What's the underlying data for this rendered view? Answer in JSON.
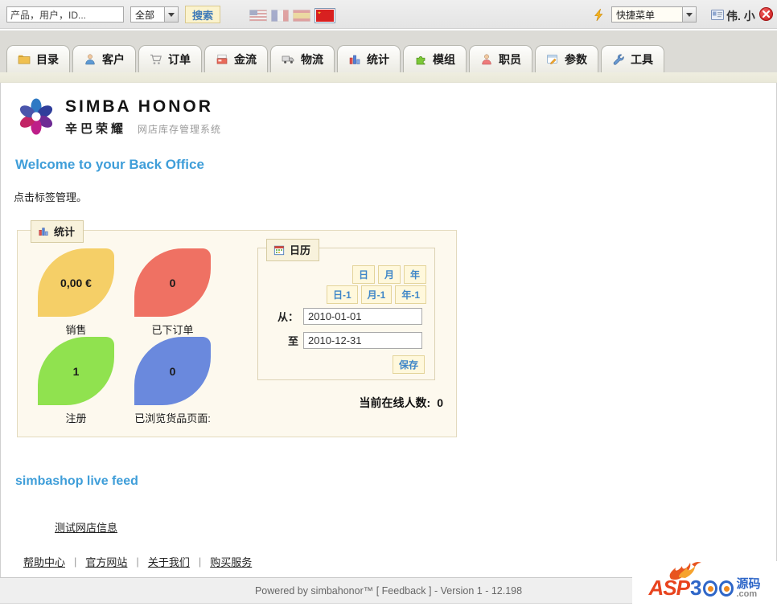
{
  "topbar": {
    "search_value": "产品，用户，ID...",
    "category_value": "全部",
    "search_button": "搜索",
    "flags": [
      "us-flag",
      "france-flag",
      "spain-flag",
      "china-flag-selected"
    ],
    "quick_menu_value": "快捷菜单",
    "username": "伟. 小"
  },
  "tabs": [
    {
      "label": "目录"
    },
    {
      "label": "客户"
    },
    {
      "label": "订单"
    },
    {
      "label": "金流"
    },
    {
      "label": "物流"
    },
    {
      "label": "统计"
    },
    {
      "label": "模组"
    },
    {
      "label": "职员"
    },
    {
      "label": "参数"
    },
    {
      "label": "工具"
    }
  ],
  "main": {
    "logo": {
      "title": "SIMBA HONOR",
      "cn": "辛巴荣耀",
      "tagline": "网店库存管理系统"
    },
    "welcome": "Welcome to your Back Office",
    "intro": "点击标签管理。",
    "stats": {
      "legend": "统计",
      "tiles": [
        {
          "value": "0,00 €",
          "label": "销售"
        },
        {
          "value": "0",
          "label": "已下订单"
        },
        {
          "value": "1",
          "label": "注册"
        },
        {
          "value": "0",
          "label": "已浏览货品页面:"
        }
      ],
      "online_label": "当前在线人数:",
      "online_value": "0"
    },
    "calendar": {
      "legend": "日历",
      "period_buttons": [
        "日",
        "月",
        "年"
      ],
      "offset_buttons": [
        "日-1",
        "月-1",
        "年-1"
      ],
      "from_label": "从：",
      "from_value": "2010-01-01",
      "to_label": "至",
      "to_value": "2010-12-31",
      "save_button": "保存"
    },
    "feed_title": "simbashop live feed",
    "feed_link": "测试网店信息",
    "links": [
      "帮助中心",
      "官方网站",
      "关于我们",
      "购买服务"
    ],
    "link_separator": "|"
  },
  "footer": {
    "powered": "Powered by simbahonor™  [ Feedback ] - Version 1 - 12.198"
  },
  "watermark": {
    "asp": "ASP",
    "three": "3",
    "cn": "源码",
    "com": ".com"
  },
  "colors": {
    "accent_blue": "#3F9ED9",
    "leaf_sales": "#F5CF67",
    "leaf_orders": "#EF7163",
    "leaf_registrations": "#90E24F",
    "leaf_pageviews": "#6A89DD",
    "panel_cream": "#FDF9EE",
    "button_cream": "#FFF8DC",
    "button_text_blue": "#3E86C8"
  }
}
